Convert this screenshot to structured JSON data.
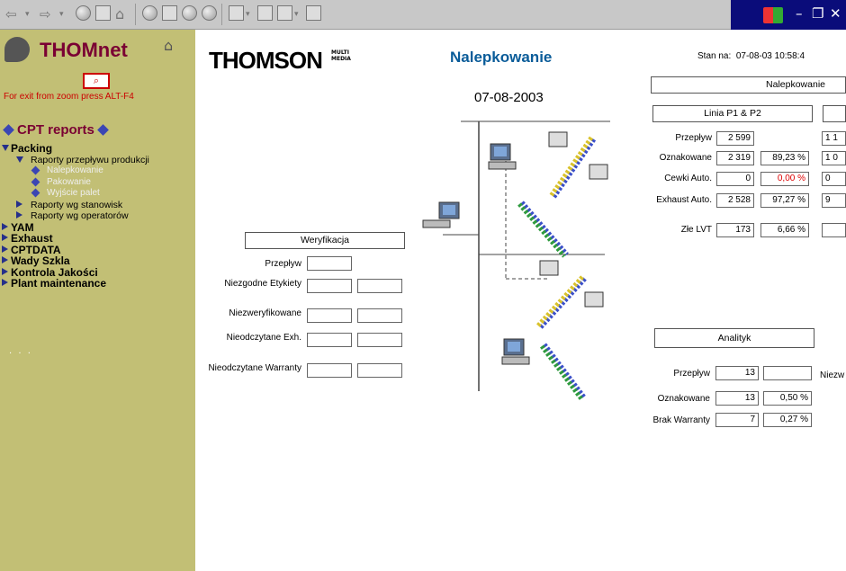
{
  "colors": {
    "sidebar_bg": "#c2bf75",
    "brand_red": "#7a0033",
    "title_blue": "#0a5c99",
    "alert_red": "#d00000"
  },
  "toolbar": {
    "icons": [
      "back-icon",
      "forward-icon",
      "stop-icon",
      "refresh-icon",
      "home-icon",
      "search-icon",
      "favorites-icon",
      "history-icon",
      "mail-icon",
      "print-icon",
      "edit-icon",
      "discuss-icon"
    ]
  },
  "window": {
    "min": "–",
    "restore": "❐",
    "close": "✕"
  },
  "sidebar": {
    "logo": "THOMnet",
    "zoom_icon": "⌕",
    "zoom_note": "For exit from zoom press ALT-F4",
    "section": "CPT reports",
    "tree": [
      {
        "label": "Packing",
        "level": 0,
        "marker": "down"
      },
      {
        "label": "Raporty przepływu produkcji",
        "level": 1,
        "marker": "down"
      },
      {
        "label": "Nalepkowanie",
        "level": 2,
        "marker": "diamond"
      },
      {
        "label": "Pakowanie",
        "level": 2,
        "marker": "diamond"
      },
      {
        "label": "Wyjście palet",
        "level": 2,
        "marker": "diamond"
      },
      {
        "label": "Raporty wg stanowisk",
        "level": 1,
        "marker": "right"
      },
      {
        "label": "Raporty wg operatorów",
        "level": 1,
        "marker": "right"
      },
      {
        "label": "YAM",
        "level": 0,
        "marker": "right"
      },
      {
        "label": "Exhaust",
        "level": 0,
        "marker": "right"
      },
      {
        "label": "CPTDATA",
        "level": 0,
        "marker": "right"
      },
      {
        "label": "Wady Szkla",
        "level": 0,
        "marker": "right"
      },
      {
        "label": "Kontrola Jakości",
        "level": 0,
        "marker": "right"
      },
      {
        "label": "Plant maintenance",
        "level": 0,
        "marker": "right"
      }
    ],
    "dots": "· · ·"
  },
  "header": {
    "brand": "THOMSON",
    "brand_small": "MULTI MEDIA",
    "title": "Nalepkowanie",
    "stan_label": "Stan na:",
    "stan_value": "07-08-03  10:58:4"
  },
  "main_date": "07-08-2003",
  "weryfikacja": {
    "title": "Weryfikacja",
    "rows": [
      "Przepływ",
      "Niezgodne Etykiety",
      "Niezweryfikowane",
      "Nieodczytane Exh.",
      "Nieodczytane Warranty"
    ]
  },
  "nalepkowanie": {
    "title": "Nalepkowanie",
    "linia": "Linia P1 & P2",
    "rows": [
      {
        "label": "Przepływ",
        "value": "2 599",
        "pct": "",
        "right": "1 1"
      },
      {
        "label": "Oznakowane",
        "value": "2 319",
        "pct": "89,23 %",
        "right": "1 0"
      },
      {
        "label": "Cewki Auto.",
        "value": "0",
        "pct": "0,00 %",
        "right": "0"
      },
      {
        "label": "Exhaust Auto.",
        "value": "2 528",
        "pct": "97,27 %",
        "right": "9"
      },
      {
        "label": "Złe LVT",
        "value": "173",
        "pct": "6,66 %",
        "right": ""
      }
    ]
  },
  "analityk": {
    "title": "Analityk",
    "side_label": "Niezw",
    "rows": [
      {
        "label": "Przepływ",
        "value": "13",
        "pct": ""
      },
      {
        "label": "Oznakowane",
        "value": "13",
        "pct": "0,50 %"
      },
      {
        "label": "Brak Warranty",
        "value": "7",
        "pct": "0,27 %"
      }
    ]
  }
}
